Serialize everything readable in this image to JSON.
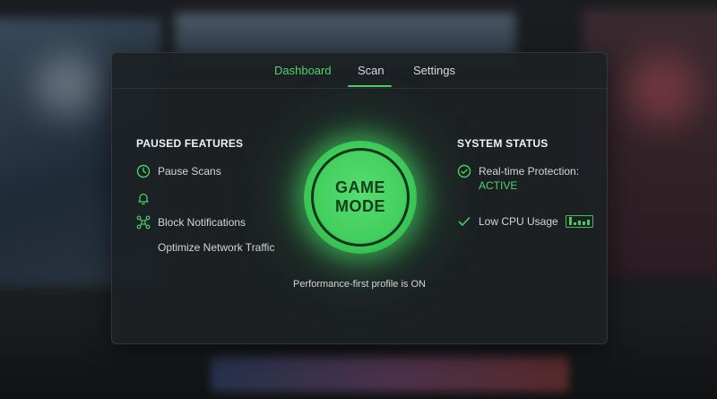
{
  "tabs": [
    {
      "label": "Dashboard"
    },
    {
      "label": "Scan"
    },
    {
      "label": "Settings"
    }
  ],
  "active_tab": "Scan",
  "paused": {
    "title": "PAUSED FEATURES",
    "items": [
      {
        "label": "Pause Scans",
        "icon": "clock-icon"
      },
      {
        "label": "",
        "icon": "bell-icon"
      },
      {
        "label": "Block Notifications",
        "icon": "network-icon"
      },
      {
        "label": "Optimize Network Traffic",
        "icon": ""
      }
    ]
  },
  "game_mode": {
    "line1": "GAME",
    "line2": "MODE"
  },
  "profile_text": "Performance-first profile is ON",
  "status": {
    "title": "SYSTEM STATUS",
    "realtime_label": "Real-time Protection:",
    "realtime_value": "ACTIVE",
    "cpu_label": "Low CPU Usage"
  },
  "colors": {
    "accent": "#46cf66",
    "panel_bg": "#1c2124",
    "text": "#d2d6d8"
  }
}
